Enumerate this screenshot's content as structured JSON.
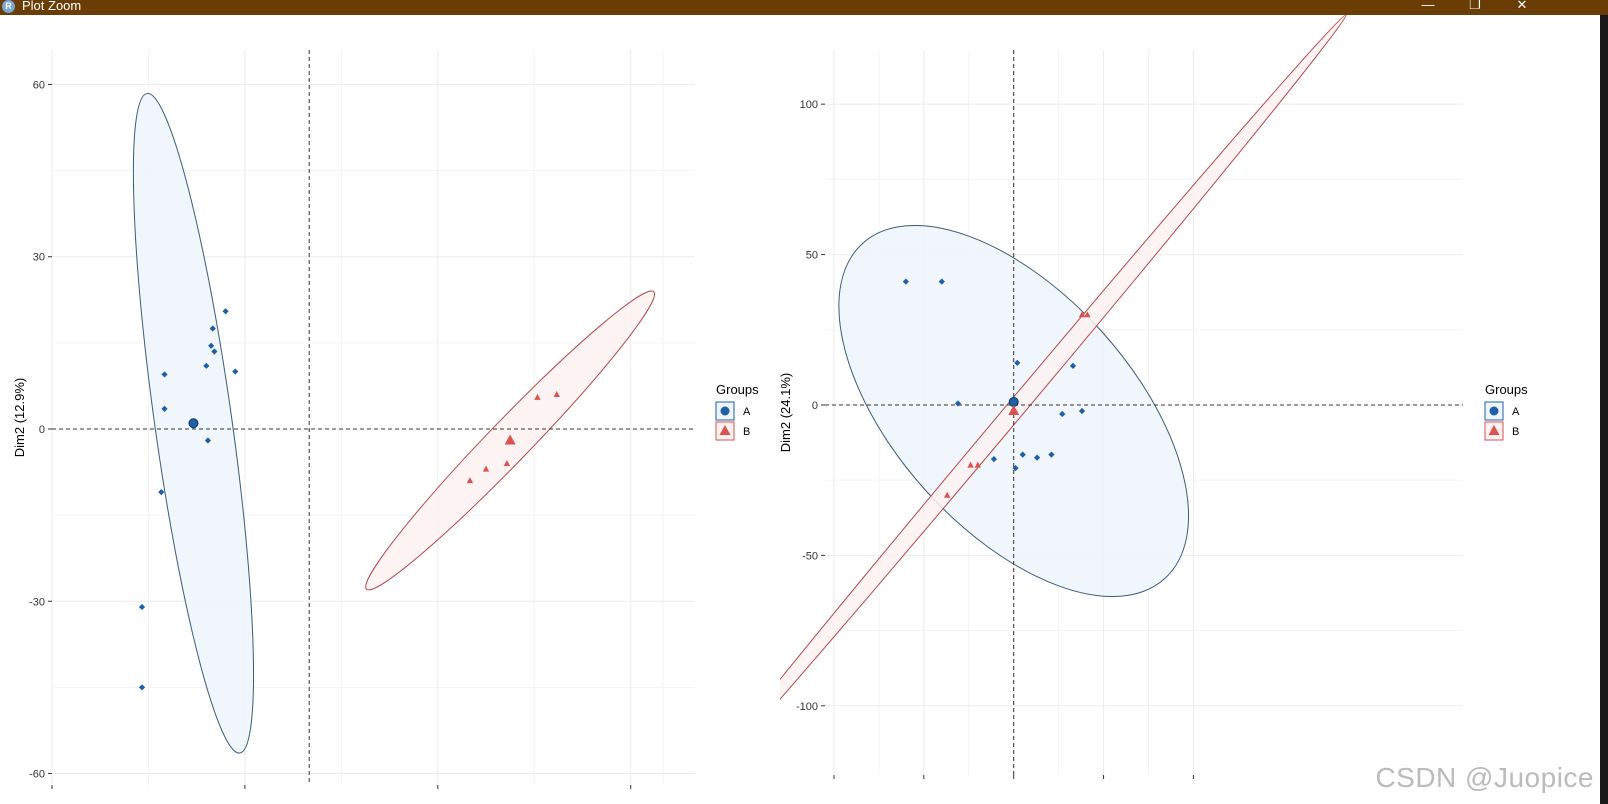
{
  "window": {
    "title": "Plot Zoom",
    "app_icon_letter": "R",
    "controls": {
      "minimize": "—",
      "maximize": "❐",
      "close": "✕"
    }
  },
  "watermark": "CSDN @Juopice",
  "colors": {
    "group_A": "#1f5fa6",
    "group_B": "#d9534f",
    "ellipse_A_fill": "#eef4fb",
    "ellipse_A_stroke": "#3b5b7e",
    "ellipse_B_fill": "#fdf1f1",
    "ellipse_B_stroke": "#b54848",
    "grid": "#ebebeb"
  },
  "chart_data": [
    {
      "type": "scatter",
      "ylabel": "Dim2 (12.9%)",
      "xlabel": "",
      "ylim": [
        -60,
        60
      ],
      "yticks": [
        60,
        30,
        0,
        -30,
        -60
      ],
      "xticks": [
        "",
        "",
        "",
        ""
      ],
      "reference_lines": {
        "x": 0,
        "y": 0
      },
      "legend": {
        "title": "Groups",
        "placement": "right",
        "entries": [
          "A",
          "B"
        ]
      },
      "series": [
        {
          "name": "A",
          "marker": "circle",
          "points": [
            [
              -26,
              20.5
            ],
            [
              -30,
              17.5
            ],
            [
              -30.5,
              14.5
            ],
            [
              -29.5,
              13.5
            ],
            [
              -45,
              9.5
            ],
            [
              -32,
              11
            ],
            [
              -23,
              10
            ],
            [
              -45,
              3.5
            ],
            [
              -31.5,
              -2
            ],
            [
              -46,
              -11
            ],
            [
              -52,
              -31
            ],
            [
              -52,
              -45
            ]
          ],
          "centroid": [
            -36,
            1
          ]
        },
        {
          "name": "B",
          "marker": "triangle",
          "points": [
            [
              77,
              6
            ],
            [
              71,
              5.5
            ],
            [
              61.5,
              -6
            ],
            [
              55,
              -7
            ],
            [
              50,
              -9
            ]
          ],
          "centroid": [
            62.5,
            -2
          ]
        }
      ]
    },
    {
      "type": "scatter",
      "ylabel": "Dim2 (24.1%)",
      "xlabel": "",
      "ylim": [
        -100,
        100
      ],
      "yticks": [
        100,
        50,
        0,
        -50,
        -100
      ],
      "xticks": [
        "",
        "",
        "",
        "",
        ""
      ],
      "reference_lines": {
        "x": 0,
        "y": 0
      },
      "legend": {
        "title": "Groups",
        "placement": "right",
        "entries": [
          "A",
          "B"
        ]
      },
      "series": [
        {
          "name": "A",
          "marker": "circle",
          "points": [
            [
              -60,
              41
            ],
            [
              -40,
              41
            ],
            [
              2,
              14
            ],
            [
              33,
              13
            ],
            [
              -31,
              0.5
            ],
            [
              27,
              -3
            ],
            [
              38,
              -2
            ],
            [
              5,
              -16.5
            ],
            [
              21,
              -16.5
            ],
            [
              13,
              -17.5
            ],
            [
              -11,
              -18
            ],
            [
              1,
              -21
            ]
          ],
          "centroid": [
            0,
            1
          ]
        },
        {
          "name": "B",
          "marker": "triangle",
          "points": [
            [
              38,
              30
            ],
            [
              41,
              30
            ],
            [
              -20,
              -20
            ],
            [
              -24,
              -20
            ],
            [
              -37,
              -30
            ]
          ],
          "centroid": [
            0,
            -2
          ]
        }
      ]
    }
  ]
}
